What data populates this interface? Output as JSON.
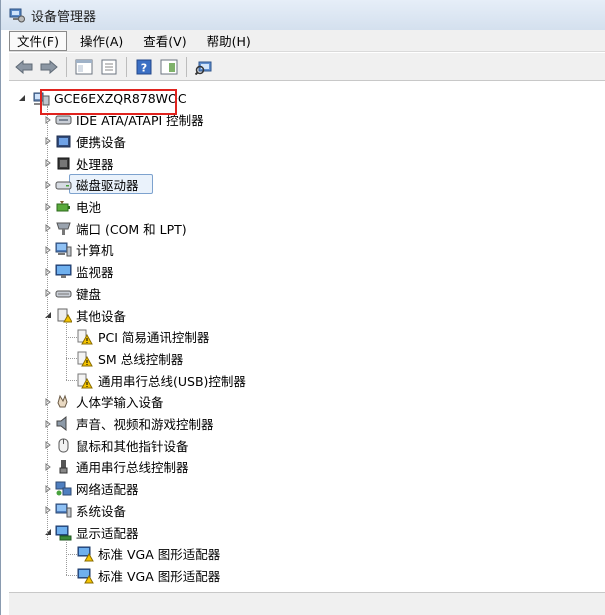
{
  "window": {
    "title": "设备管理器"
  },
  "menu": {
    "file": "文件(F)",
    "action": "操作(A)",
    "view": "查看(V)",
    "help": "帮助(H)"
  },
  "toolbar": {
    "icons": [
      "back-arrow-icon",
      "forward-arrow-icon",
      "console-tree-icon",
      "properties-icon",
      "help-icon",
      "scope-pane-icon",
      "scan-hardware-icon"
    ]
  },
  "tree": {
    "root": "GCE6EXZQR878WOC",
    "categories": [
      {
        "label": "IDE ATA/ATAPI 控制器"
      },
      {
        "label": "便携设备"
      },
      {
        "label": "处理器"
      },
      {
        "label": "磁盘驱动器"
      },
      {
        "label": "电池"
      },
      {
        "label": "端口 (COM 和 LPT)"
      },
      {
        "label": "计算机"
      },
      {
        "label": "监视器"
      },
      {
        "label": "键盘"
      },
      {
        "label": "其他设备",
        "children": [
          "PCI 简易通讯控制器",
          "SM 总线控制器",
          "通用串行总线(USB)控制器"
        ]
      },
      {
        "label": "人体学输入设备"
      },
      {
        "label": "声音、视频和游戏控制器"
      },
      {
        "label": "鼠标和其他指针设备"
      },
      {
        "label": "通用串行总线控制器"
      },
      {
        "label": "网络适配器"
      },
      {
        "label": "系统设备"
      },
      {
        "label": "显示适配器",
        "children": [
          "标准 VGA 图形适配器",
          "标准 VGA 图形适配器"
        ]
      }
    ]
  },
  "colors": {
    "highlight": "#e0231e",
    "warning": "#f5c400"
  }
}
